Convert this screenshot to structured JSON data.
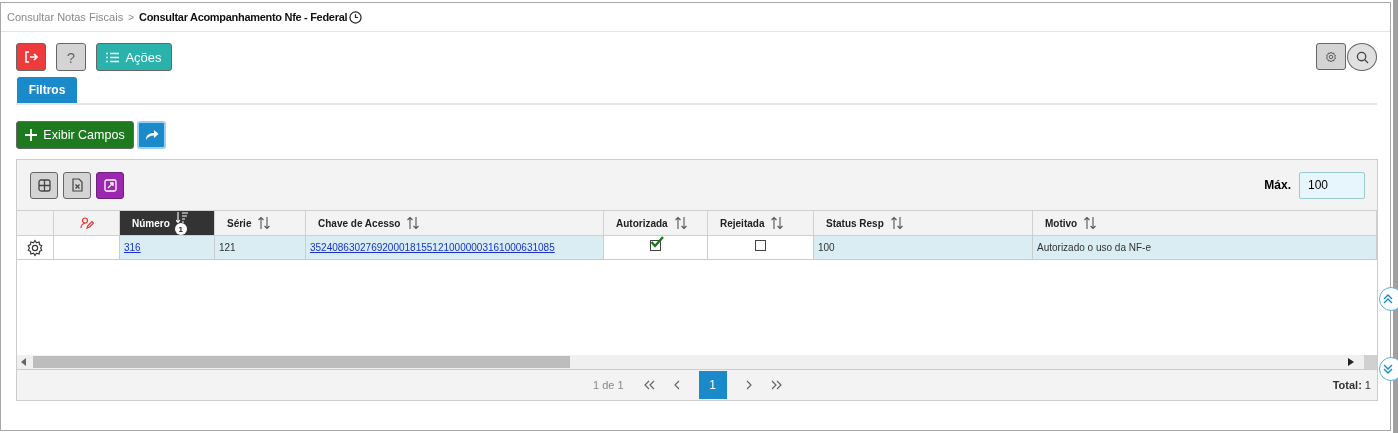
{
  "breadcrumb": {
    "items": [
      {
        "label": "Consultar Notas Fiscais",
        "current": false
      },
      {
        "label": "Consultar Acompanhamento Nfe - Federal",
        "current": true
      }
    ],
    "separator": ">"
  },
  "toolbar": {
    "help_label": "?",
    "actions_label": "Ações"
  },
  "tabs": [
    {
      "label": "Filtros",
      "selected": true
    }
  ],
  "show_fields_label": "Exibir Campos",
  "grid": {
    "max_label": "Máx.",
    "max_value": "100",
    "columns": [
      {
        "kind": "settings"
      },
      {
        "kind": "user"
      },
      {
        "kind": "text",
        "label": "Número",
        "sorted": true,
        "sort_rank": "1"
      },
      {
        "kind": "text",
        "label": "Série",
        "sorted": false
      },
      {
        "kind": "text",
        "label": "Chave de Acesso",
        "sorted": false
      },
      {
        "kind": "text",
        "label": "Autorizada",
        "sorted": false
      },
      {
        "kind": "text",
        "label": "Rejeitada",
        "sorted": false
      },
      {
        "kind": "text",
        "label": "Status Resp",
        "sorted": false
      },
      {
        "kind": "text",
        "label": "Motivo",
        "sorted": false
      }
    ],
    "rows": [
      {
        "selected": true,
        "numero": "316",
        "serie": "121",
        "chave": "35240863027692000181551210000003161000631085",
        "autorizada": true,
        "rejeitada": false,
        "status": "100",
        "motivo": "Autorizado o uso da NF-e"
      }
    ],
    "pagination": {
      "info": "1 de 1",
      "pages": [
        {
          "label": "1",
          "selected": true
        }
      ],
      "total_label": "Total:",
      "total": "1"
    }
  }
}
